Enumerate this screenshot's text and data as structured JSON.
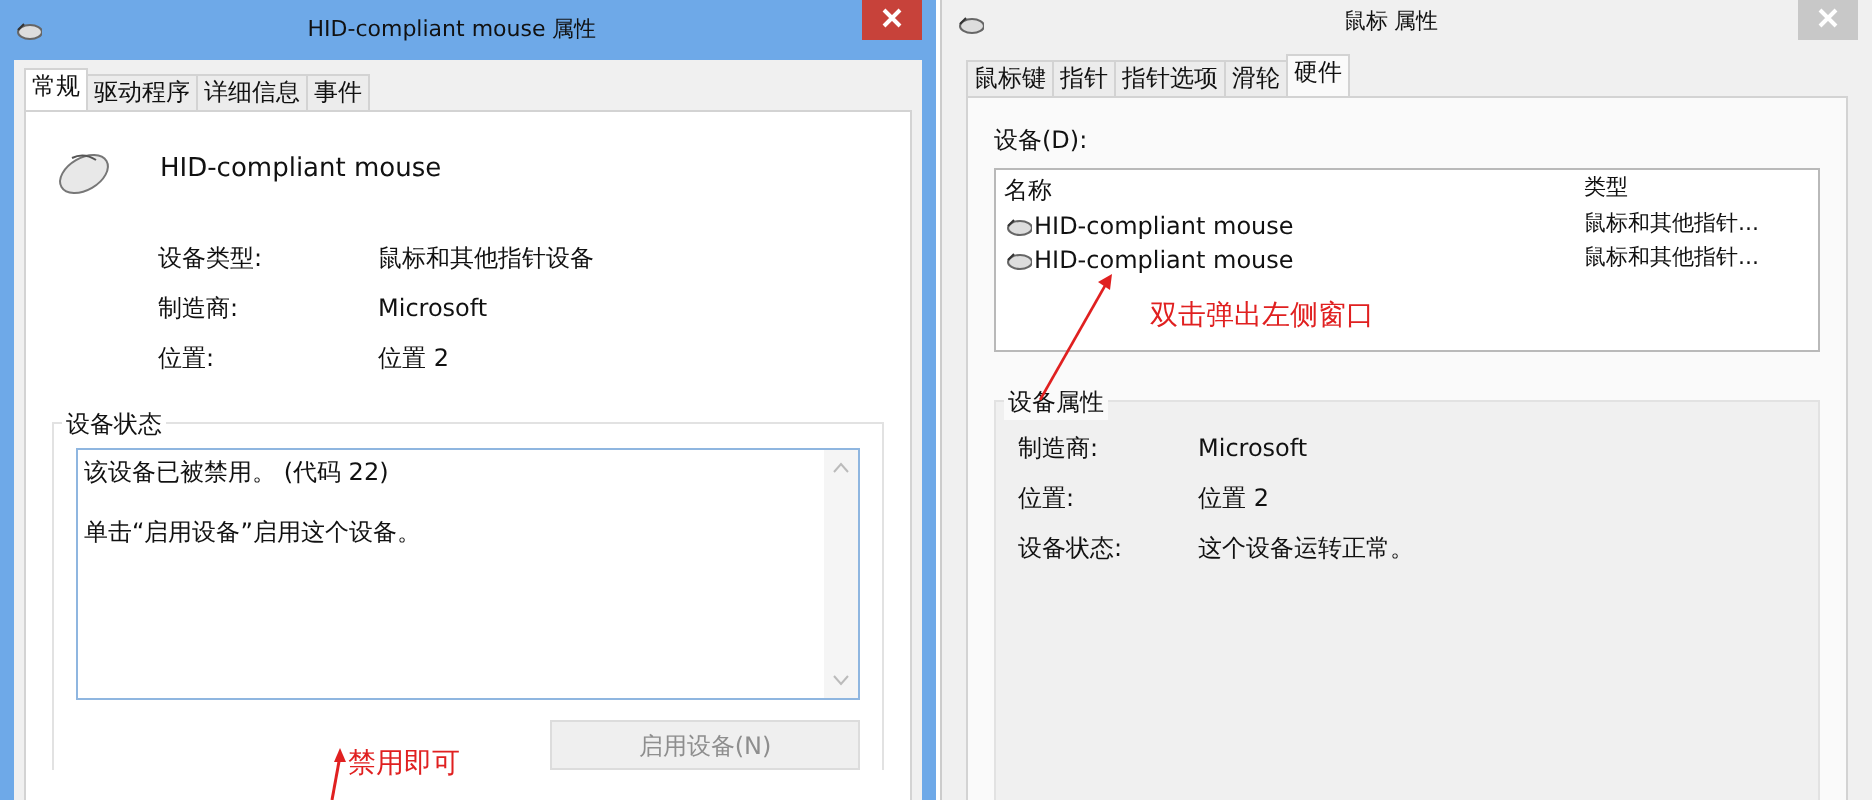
{
  "left_window": {
    "title": "HID-compliant mouse 属性",
    "active": true,
    "tabs": [
      {
        "label": "常规",
        "selected": true
      },
      {
        "label": "驱动程序",
        "selected": false
      },
      {
        "label": "详细信息",
        "selected": false
      },
      {
        "label": "事件",
        "selected": false
      }
    ],
    "device_name": "HID-compliant mouse",
    "properties": [
      {
        "label": "设备类型:",
        "value": "鼠标和其他指针设备"
      },
      {
        "label": "制造商:",
        "value": "Microsoft"
      },
      {
        "label": "位置:",
        "value": "位置 2"
      }
    ],
    "status_group": {
      "title": "设备状态",
      "lines": [
        "该设备已被禁用。 (代码 22)",
        "单击“启用设备”启用这个设备。"
      ]
    },
    "button": {
      "label": "启用设备(N)",
      "disabled": true
    }
  },
  "right_window": {
    "title": "鼠标 属性",
    "active": false,
    "tabs": [
      {
        "label": "鼠标键",
        "selected": false
      },
      {
        "label": "指针",
        "selected": false
      },
      {
        "label": "指针选项",
        "selected": false
      },
      {
        "label": "滑轮",
        "selected": false
      },
      {
        "label": "硬件",
        "selected": true
      }
    ],
    "devices_label": "设备(D):",
    "columns": [
      "名称",
      "类型"
    ],
    "rows": [
      {
        "name": "HID-compliant mouse",
        "type": "鼠标和其他指针...",
        "selected": false
      },
      {
        "name": "HID-compliant mouse",
        "type": "鼠标和其他指针...",
        "selected": false
      }
    ],
    "properties_group": {
      "title": "设备属性",
      "properties": [
        {
          "label": "制造商:",
          "value": "Microsoft"
        },
        {
          "label": "位置:",
          "value": "位置 2"
        },
        {
          "label": "设备状态:",
          "value": "这个设备运转正常。"
        }
      ]
    }
  },
  "annotations": [
    {
      "text": "禁用即可"
    },
    {
      "text": "双击弹出左侧窗口"
    }
  ]
}
